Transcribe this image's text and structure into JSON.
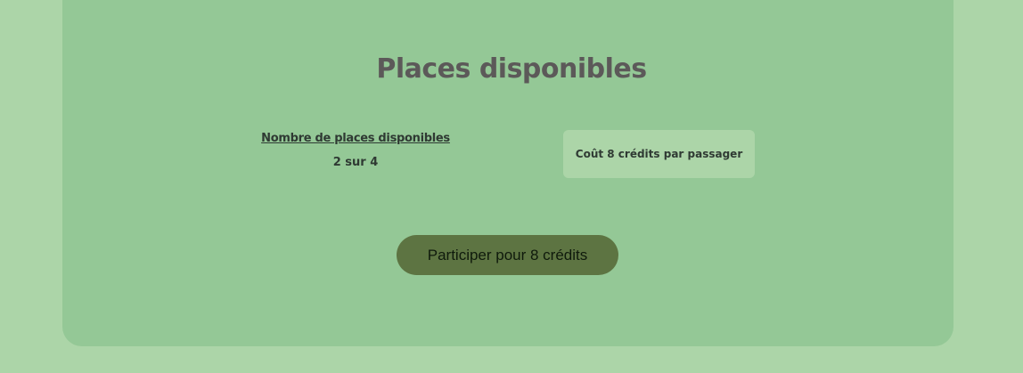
{
  "section": {
    "title": "Places disponibles"
  },
  "places": {
    "label": "Nombre de places disponibles",
    "value": "2 sur 4"
  },
  "cost": {
    "text": "Coût 8 crédits par passager"
  },
  "action": {
    "join_label": "Participer pour 8 crédits"
  },
  "colors": {
    "page_background": "#acd5a8",
    "card_background": "#94c896",
    "button_background": "#5d7442",
    "title_text": "#5c5959"
  }
}
